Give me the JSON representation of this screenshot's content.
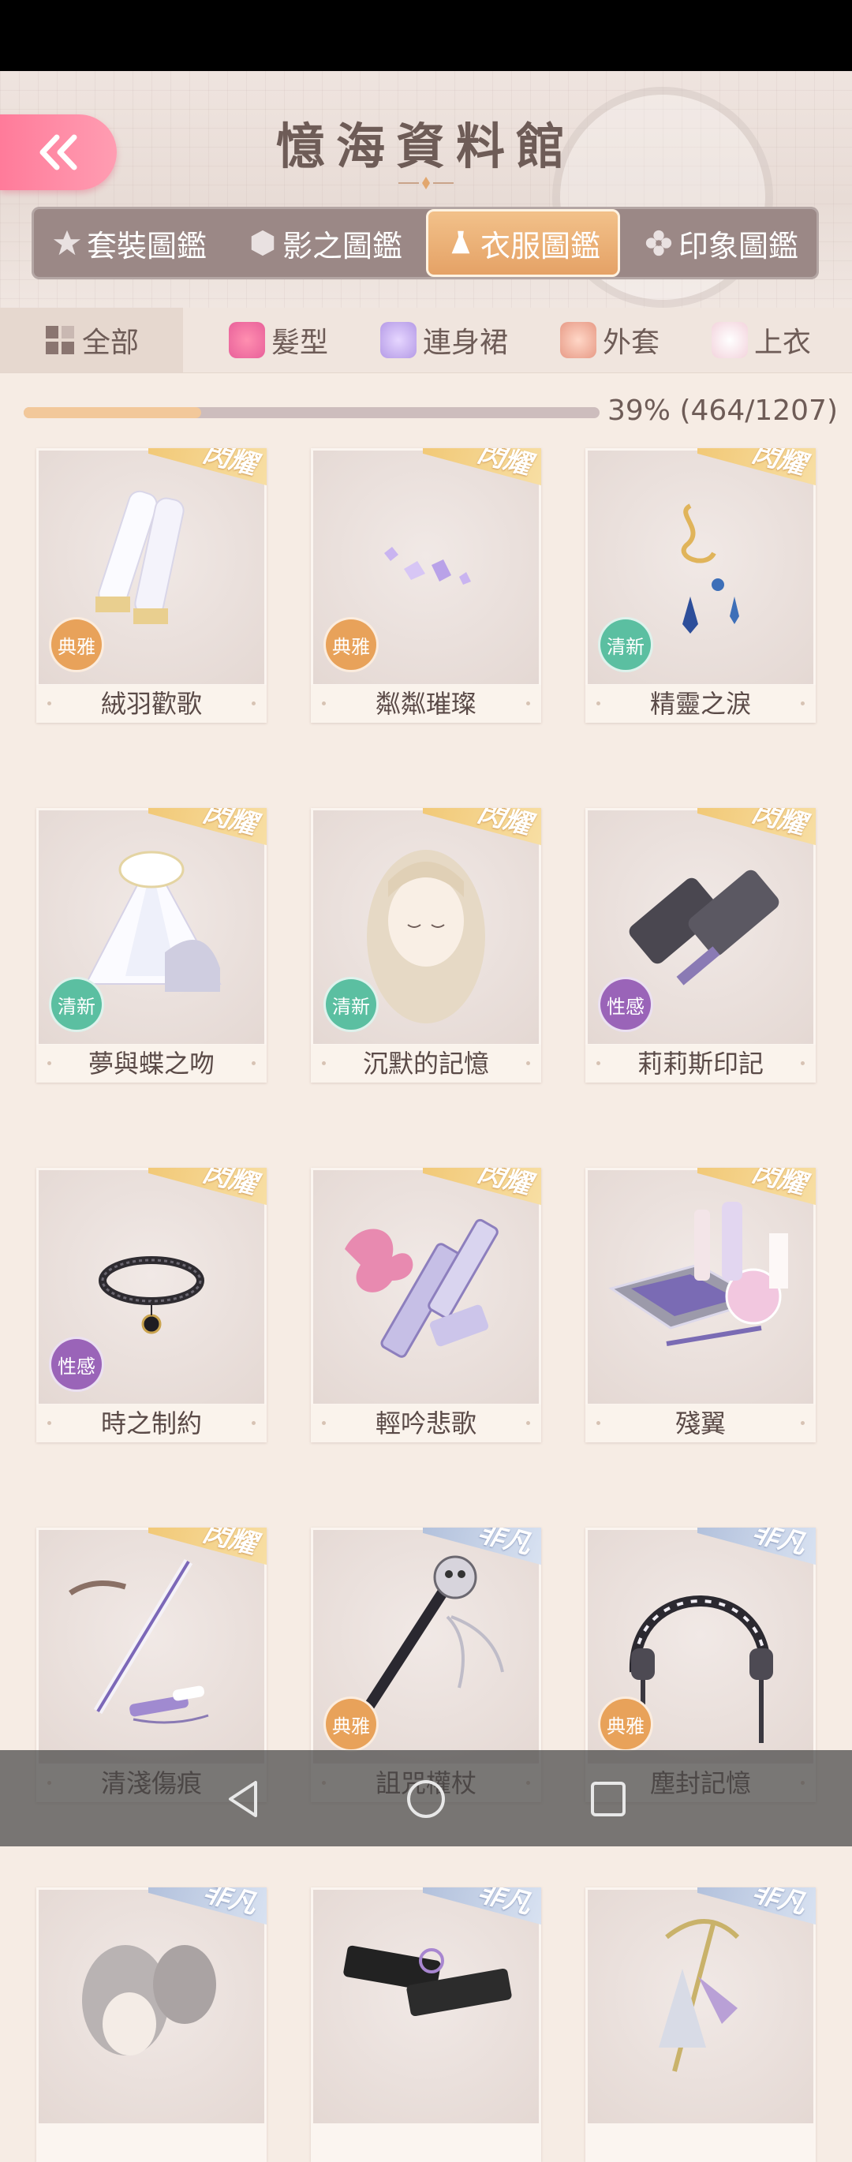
{
  "header": {
    "title": "憶海資料館"
  },
  "tabs": [
    {
      "label": "套裝圖鑑",
      "icon": "star-icon",
      "active": false
    },
    {
      "label": "影之圖鑑",
      "icon": "hexagon-icon",
      "active": false
    },
    {
      "label": "衣服圖鑑",
      "icon": "dress-icon",
      "active": true
    },
    {
      "label": "印象圖鑑",
      "icon": "flower-icon",
      "active": false
    }
  ],
  "categories": [
    {
      "label": "全部",
      "active": true
    },
    {
      "label": "髮型"
    },
    {
      "label": "連身裙"
    },
    {
      "label": "外套"
    },
    {
      "label": "上衣"
    }
  ],
  "progress": {
    "text": "39% (464/1207)",
    "value": 0.39
  },
  "items": [
    {
      "name": "絨羽歡歌",
      "rarity": "閃耀",
      "tag": "典雅",
      "tagType": "dianya",
      "art": "gloves"
    },
    {
      "name": "粼粼璀璨",
      "rarity": "閃耀",
      "tag": "典雅",
      "tagType": "dianya",
      "art": "gems"
    },
    {
      "name": "精靈之淚",
      "rarity": "閃耀",
      "tag": "清新",
      "tagType": "qingxin",
      "art": "earring"
    },
    {
      "name": "夢與蝶之吻",
      "rarity": "閃耀",
      "tag": "清新",
      "tagType": "qingxin",
      "art": "dress"
    },
    {
      "name": "沉默的記憶",
      "rarity": "閃耀",
      "tag": "清新",
      "tagType": "qingxin",
      "art": "hair"
    },
    {
      "name": "莉莉斯印記",
      "rarity": "閃耀",
      "tag": "性感",
      "tagType": "xinggan",
      "art": "gloves-dark"
    },
    {
      "name": "時之制約",
      "rarity": "閃耀",
      "tag": "性感",
      "tagType": "xinggan",
      "art": "choker"
    },
    {
      "name": "輕吟悲歌",
      "rarity": "閃耀",
      "tag": "",
      "tagType": "",
      "art": "lipstick"
    },
    {
      "name": "殘翼",
      "rarity": "閃耀",
      "tag": "",
      "tagType": "",
      "art": "makeup"
    },
    {
      "name": "清淺傷痕",
      "rarity": "閃耀",
      "tag": "",
      "tagType": "",
      "art": "pen"
    },
    {
      "name": "詛咒權杖",
      "rarity": "非凡",
      "tag": "典雅",
      "tagType": "dianya",
      "art": "scepter"
    },
    {
      "name": "塵封記憶",
      "rarity": "非凡",
      "tag": "典雅",
      "tagType": "dianya",
      "art": "headband"
    },
    {
      "name": "",
      "rarity": "非凡",
      "tag": "",
      "tagType": "",
      "art": "hair-gray"
    },
    {
      "name": "",
      "rarity": "非凡",
      "tag": "",
      "tagType": "",
      "art": "belt"
    },
    {
      "name": "",
      "rarity": "非凡",
      "tag": "",
      "tagType": "",
      "art": "umbrella"
    }
  ],
  "colors": {
    "accent": "#e5a266",
    "back": "#ff8aa6",
    "badge_dianya": "#e8a25a",
    "badge_qingxin": "#5bbfa1",
    "badge_xinggan": "#9a64b8"
  }
}
